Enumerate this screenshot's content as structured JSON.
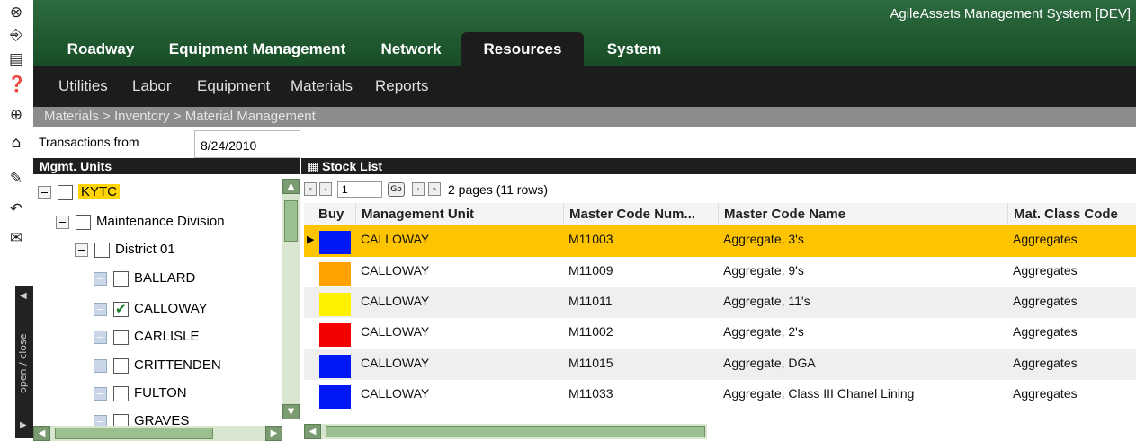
{
  "app": {
    "title": "AgileAssets Management System [DEV]"
  },
  "left_rail": {
    "icons": [
      "close-icon",
      "exit-icon",
      "save-icon",
      "help-icon",
      "add-icon",
      "home-icon",
      "edit-icon",
      "undo-icon",
      "mail-icon"
    ],
    "toggle_label": "open / close"
  },
  "main_tabs": [
    {
      "label": "Roadway"
    },
    {
      "label": "Equipment Management"
    },
    {
      "label": "Network"
    },
    {
      "label": "Resources",
      "active": true
    },
    {
      "label": "System"
    }
  ],
  "sub_nav": [
    {
      "label": "Utilities"
    },
    {
      "label": "Labor"
    },
    {
      "label": "Equipment"
    },
    {
      "label": "Materials"
    },
    {
      "label": "Reports"
    }
  ],
  "breadcrumb": "Materials > Inventory > Material Management",
  "filter": {
    "label": "Transactions from",
    "date": "8/24/2010"
  },
  "mgmt_units": {
    "title": "Mgmt. Units",
    "tree": [
      {
        "label": "KYTC",
        "level": 0,
        "highlight": true,
        "checked": false
      },
      {
        "label": "Maintenance Division",
        "level": 1,
        "checked": false
      },
      {
        "label": "District 01",
        "level": 2,
        "checked": false
      },
      {
        "label": "BALLARD",
        "level": 3,
        "checked": false
      },
      {
        "label": "CALLOWAY",
        "level": 3,
        "checked": true
      },
      {
        "label": "CARLISLE",
        "level": 3,
        "checked": false
      },
      {
        "label": "CRITTENDEN",
        "level": 3,
        "checked": false
      },
      {
        "label": "FULTON",
        "level": 3,
        "checked": false
      },
      {
        "label": "GRAVES",
        "level": 3,
        "checked": false
      }
    ]
  },
  "stock_list": {
    "title": "Stock List",
    "pager": {
      "page": "1",
      "go_label": "Go",
      "info": "2 pages (11 rows)"
    },
    "columns": [
      "Buy",
      "Management Unit",
      "Master Code Num...",
      "Master Code Name",
      "Mat. Class Code"
    ],
    "rows": [
      {
        "color": "#0018f5",
        "unit": "CALLOWAY",
        "code": "M11003",
        "name": "Aggregate, 3's",
        "class": "Aggregates",
        "selected": true
      },
      {
        "color": "#ffa200",
        "unit": "CALLOWAY",
        "code": "M11009",
        "name": "Aggregate, 9's",
        "class": "Aggregates"
      },
      {
        "color": "#fff200",
        "unit": "CALLOWAY",
        "code": "M11011",
        "name": "Aggregate, 11's",
        "class": "Aggregates"
      },
      {
        "color": "#f50000",
        "unit": "CALLOWAY",
        "code": "M11002",
        "name": "Aggregate, 2's",
        "class": "Aggregates"
      },
      {
        "color": "#0018f5",
        "unit": "CALLOWAY",
        "code": "M11015",
        "name": "Aggregate, DGA",
        "class": "Aggregates"
      },
      {
        "color": "#0018f5",
        "unit": "CALLOWAY",
        "code": "M11033",
        "name": "Aggregate, Class III Chanel Lining",
        "class": "Aggregates"
      }
    ]
  },
  "colors": {
    "brand_green": "#1f5c31",
    "selected_row": "#ffc400",
    "highlight": "#ffd400"
  }
}
